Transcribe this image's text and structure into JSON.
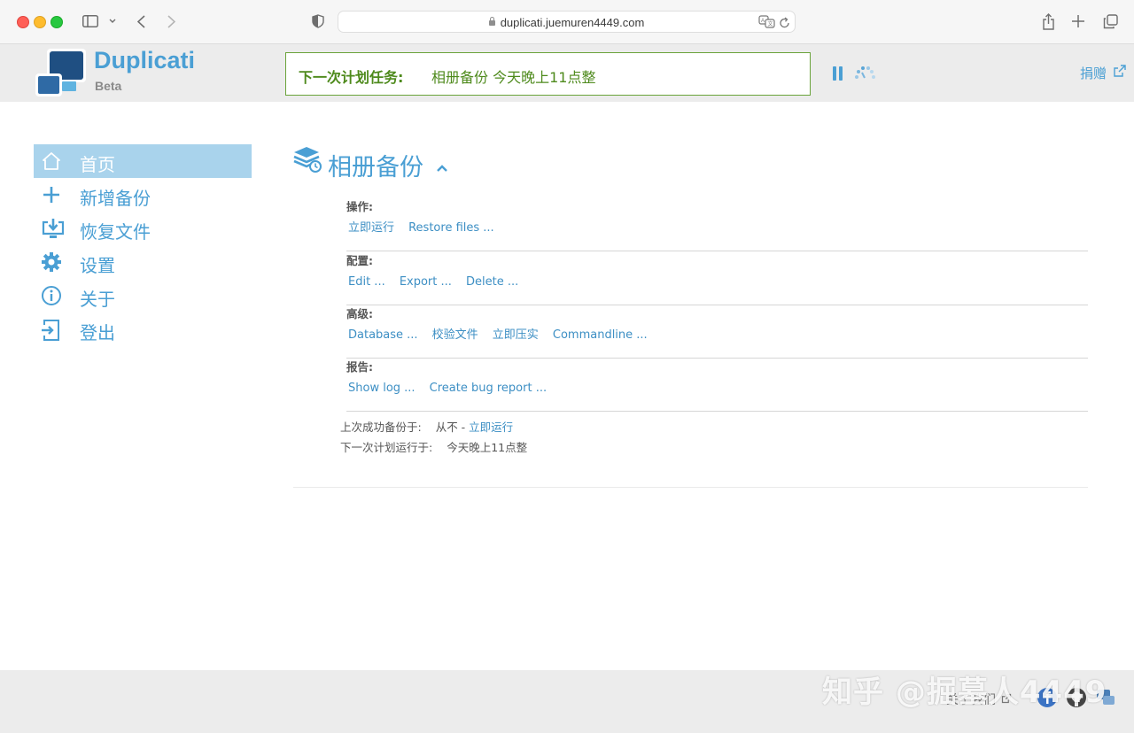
{
  "browser": {
    "url": "duplicati.juemuren4449.com"
  },
  "header": {
    "brand": "Duplicati",
    "badge": "Beta",
    "schedule_label": "下一次计划任务:",
    "schedule_value": "相册备份 今天晚上11点整",
    "donate": "捐赠"
  },
  "sidebar": {
    "items": [
      {
        "label": "首页",
        "icon": "home-icon",
        "active": true
      },
      {
        "label": "新增备份",
        "icon": "plus-icon"
      },
      {
        "label": "恢复文件",
        "icon": "restore-icon"
      },
      {
        "label": "设置",
        "icon": "gear-icon"
      },
      {
        "label": "关于",
        "icon": "info-icon"
      },
      {
        "label": "登出",
        "icon": "logout-icon"
      }
    ]
  },
  "backup": {
    "title": "相册备份",
    "sections": [
      {
        "label": "操作:",
        "links": [
          "立即运行",
          "Restore files ..."
        ]
      },
      {
        "label": "配置:",
        "links": [
          "Edit ...",
          "Export ...",
          "Delete ..."
        ]
      },
      {
        "label": "高级:",
        "links": [
          "Database ...",
          "校验文件",
          "立即压实",
          "Commandline ..."
        ]
      },
      {
        "label": "报告:",
        "links": [
          "Show log ...",
          "Create bug report ..."
        ]
      }
    ],
    "last_success_label": "上次成功备份于:",
    "last_success_value": "从不 -",
    "last_success_link": "立即运行",
    "next_run_label": "下一次计划运行于:",
    "next_run_value": "今天晚上11点整"
  },
  "footer": {
    "link": "关于我们",
    "watermark": "知乎 @掘墓人4449"
  },
  "colors": {
    "accent": "#4a9fd4",
    "active_nav_bg": "#a9d3ec",
    "schedule_green": "#4e8a1c",
    "header_bg": "#ececec"
  }
}
